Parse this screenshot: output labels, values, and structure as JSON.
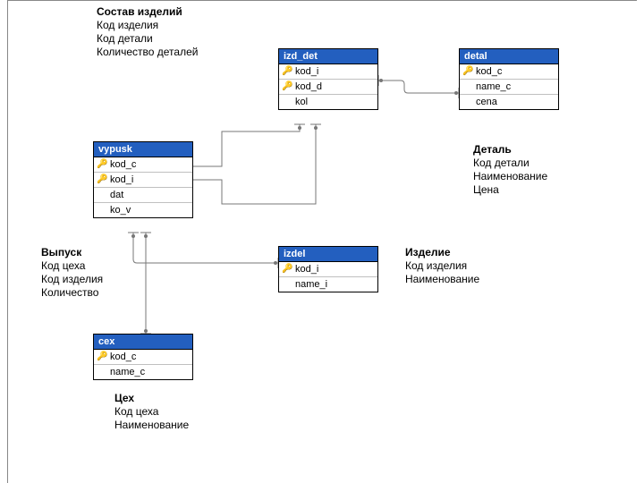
{
  "labels": {
    "sostav": {
      "title": "Состав изделий",
      "lines": [
        "Код изделия",
        "Код детали",
        "Количество деталей"
      ]
    },
    "detal": {
      "title": "Деталь",
      "lines": [
        "Код детали",
        "Наименование",
        "Цена"
      ]
    },
    "vypusk": {
      "title": "Выпуск",
      "lines": [
        "Код цеха",
        "Код изделия",
        "Количество"
      ]
    },
    "izdelie": {
      "title": "Изделие",
      "lines": [
        "Код изделия",
        "Наименование"
      ]
    },
    "cex": {
      "title": "Цех",
      "lines": [
        "Код цеха",
        "Наименование"
      ]
    }
  },
  "tables": {
    "izd_det": {
      "title": "izd_det",
      "fields": [
        {
          "name": "kod_i",
          "key": true
        },
        {
          "name": "kod_d",
          "key": true
        },
        {
          "name": "kol",
          "key": false
        }
      ]
    },
    "detal": {
      "title": "detal",
      "fields": [
        {
          "name": "kod_c",
          "key": true
        },
        {
          "name": "name_c",
          "key": false
        },
        {
          "name": "cena",
          "key": false
        }
      ]
    },
    "vypusk": {
      "title": "vypusk",
      "fields": [
        {
          "name": "kod_c",
          "key": true
        },
        {
          "name": "kod_i",
          "key": true
        },
        {
          "name": "dat",
          "key": false
        },
        {
          "name": "ko_v",
          "key": false
        }
      ]
    },
    "izdel": {
      "title": "izdel",
      "fields": [
        {
          "name": "kod_i",
          "key": true
        },
        {
          "name": "name_i",
          "key": false
        }
      ]
    },
    "cex": {
      "title": "cex",
      "fields": [
        {
          "name": "kod_c",
          "key": true
        },
        {
          "name": "name_c",
          "key": false
        }
      ]
    }
  }
}
